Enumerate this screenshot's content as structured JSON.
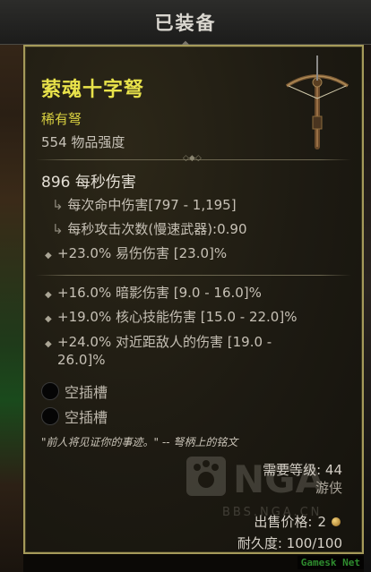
{
  "header": {
    "title": "已装备"
  },
  "item": {
    "name": "萦魂十字弩",
    "type": "稀有弩",
    "power": "554 物品强度",
    "icon": "crossbow-icon"
  },
  "stats": {
    "dps": "896 每秒伤害",
    "damage_per_hit": "每次命中伤害[797 - 1,195]",
    "attacks_per_sec": "每秒攻击次数(慢速武器):0.90",
    "implicit": "+23.0% 易伤伤害 [23.0]%"
  },
  "affixes": [
    "+16.0% 暗影伤害 [9.0 - 16.0]%",
    "+19.0% 核心技能伤害 [15.0 - 22.0]%",
    "+24.0% 对近距敌人的伤害 [19.0 -",
    "26.0]%"
  ],
  "sockets": [
    {
      "label": "空插槽"
    },
    {
      "label": "空插槽"
    }
  ],
  "flavor_text": "\"前人将见证你的事迹。\" -- 弩柄上的铭文",
  "requirements": {
    "level": "需要等级: 44",
    "class": "游侠"
  },
  "sell": {
    "label": "出售价格:",
    "value": "2"
  },
  "durability": "耐久度: 100/100",
  "watermark_text": "BBS.NGA.CN",
  "stamp": "Gamesk Net",
  "colors": {
    "name": "#e8e24a",
    "border": "#a59a5a",
    "type": "#d8d040"
  }
}
